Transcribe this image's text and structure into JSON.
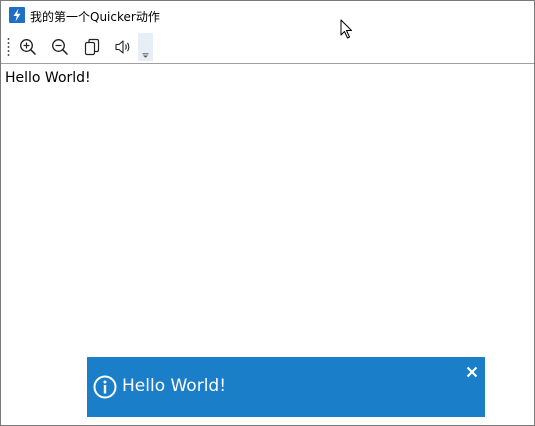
{
  "window": {
    "title": "我的第一个Quicker动作",
    "app_icon": "lightning-icon"
  },
  "toolbar": {
    "buttons": [
      {
        "name": "zoom-in",
        "icon": "zoom-in-icon"
      },
      {
        "name": "zoom-out",
        "icon": "zoom-out-icon"
      },
      {
        "name": "copy",
        "icon": "copy-icon"
      },
      {
        "name": "speak",
        "icon": "speaker-icon"
      }
    ],
    "overflow_icon": "chevron-down-icon"
  },
  "content": {
    "text": "Hello World!"
  },
  "toast": {
    "icon": "info-icon",
    "message": "Hello World!",
    "close_icon": "close-icon",
    "background": "#1a7ec8"
  },
  "colors": {
    "accent": "#1f6fc5"
  }
}
